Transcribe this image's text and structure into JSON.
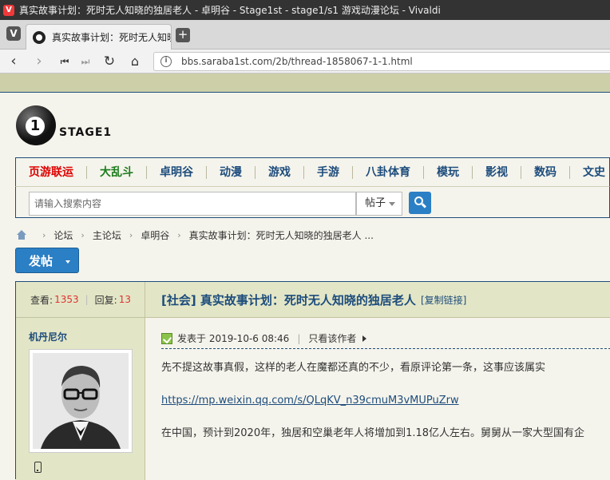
{
  "window": {
    "title": "真实故事计划：死时无人知晓的独居老人 - 卓明谷 - Stage1st - stage1/s1 游戏动漫论坛 - Vivaldi"
  },
  "browser": {
    "tab_title": "真实故事计划：死时无人知晓的独居老人",
    "url": "bbs.saraba1st.com/2b/thread-1858067-1-1.html"
  },
  "site": {
    "logo_text": "STAGE1",
    "logo_number": "1"
  },
  "nav": {
    "items": [
      "页游联运",
      "大乱斗",
      "卓明谷",
      "动漫",
      "游戏",
      "手游",
      "八卦体育",
      "模玩",
      "影视",
      "数码",
      "文史"
    ]
  },
  "search": {
    "placeholder": "请输入搜索内容",
    "scope": "帖子"
  },
  "breadcrumb": {
    "items": [
      "论坛",
      "主论坛",
      "卓明谷",
      "真实故事计划：死时无人知晓的独居老人 ..."
    ]
  },
  "post_button": {
    "label": "发帖"
  },
  "thread": {
    "views_label": "查看:",
    "views": "1353",
    "replies_label": "回复:",
    "replies": "13",
    "title": "[社会] 真实故事计划：死时无人知晓的独居老人",
    "copy_link": "[复制链接]",
    "author": "机丹尼尔",
    "posted_at": "发表于 2019-10-6 08:46",
    "only_author": "只看该作者",
    "content": {
      "line1": "先不提这故事真假，这样的老人在魔都还真的不少，看原评论第一条，这事应该属实",
      "link": "https://mp.weixin.qq.com/s/QLqKV_n39cmuM3vMUPuZrw",
      "line3": "在中国，预计到2020年，独居和空巢老年人将增加到1.18亿人左右。舅舅从一家大型国有企"
    }
  },
  "colors": {
    "accent_blue": "#1d4c7c",
    "button_blue": "#2b7fc4",
    "panel_bg": "#e3e6c6",
    "page_bg": "#f5f4ec",
    "hot_red": "#dd0000",
    "nav_green": "#1a7b1a"
  }
}
